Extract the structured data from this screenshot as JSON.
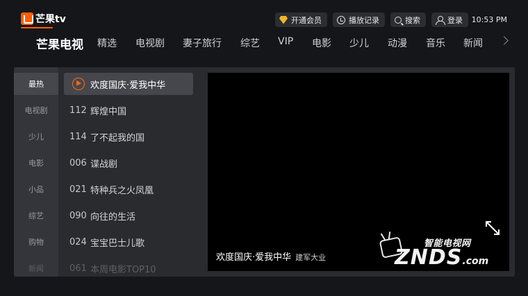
{
  "app": {
    "logo_text": "芒果tv"
  },
  "topbar": {
    "actions": [
      {
        "label": "开通会员",
        "icon": "vip-diamond-icon"
      },
      {
        "label": "播放记录",
        "icon": "history-clock-icon"
      },
      {
        "label": "搜索",
        "icon": "search-icon"
      },
      {
        "label": "登录",
        "icon": "user-icon"
      }
    ],
    "time": "10:53 PM"
  },
  "nav": {
    "tabs": [
      "芒果电视",
      "精选",
      "电视剧",
      "妻子旅行",
      "综艺",
      "VIP",
      "电影",
      "少儿",
      "动漫",
      "音乐",
      "新闻"
    ],
    "active_index": 0
  },
  "categories": {
    "items": [
      "最热",
      "电视剧",
      "少儿",
      "电影",
      "小品",
      "综艺",
      "购物",
      "新闻"
    ],
    "active_index": 0
  },
  "channels": [
    {
      "num": "",
      "name": "欢度国庆·爱我中华",
      "playing": true
    },
    {
      "num": "112",
      "name": "辉煌中国"
    },
    {
      "num": "114",
      "name": "了不起我的国"
    },
    {
      "num": "006",
      "name": "谍战剧"
    },
    {
      "num": "021",
      "name": "特种兵之火凤凰"
    },
    {
      "num": "090",
      "name": "向往的生活"
    },
    {
      "num": "024",
      "name": "宝宝巴士儿歌"
    },
    {
      "num": "061",
      "name": "本周电影TOP10"
    }
  ],
  "player": {
    "title": "欢度国庆·爱我中华",
    "subtitle": "建军大业"
  },
  "watermark": {
    "cn": "智能电视网",
    "en": "ZNDS",
    "suffix": ".com"
  },
  "colors": {
    "accent": "#ff6a0f",
    "vip": "#f2b52b",
    "bg": "#151619",
    "panel": "#2a2b2f"
  }
}
